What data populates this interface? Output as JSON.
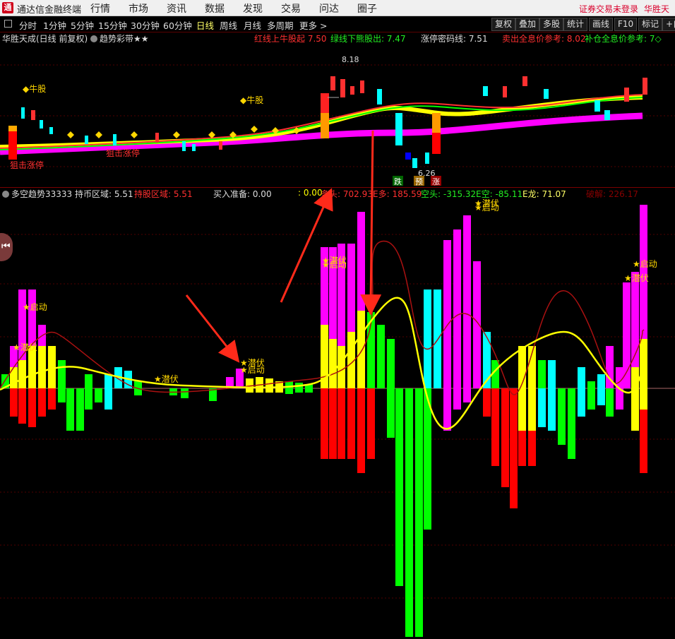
{
  "app": {
    "logo_text": "通",
    "title": "通达信金融终端",
    "menu": [
      "行情",
      "市场",
      "资讯",
      "数据",
      "发现",
      "交易",
      "问达",
      "圈子"
    ],
    "status_warn": "证券交易未登录",
    "stock_short": "华胜天成"
  },
  "toolbar": {
    "periods": [
      "分时",
      "1分钟",
      "5分钟",
      "15分钟",
      "30分钟",
      "60分钟",
      "日线",
      "周线",
      "月线",
      "多周期",
      "更多 >"
    ],
    "active_period": "日线",
    "right_buttons": [
      "复权",
      "叠加",
      "多股",
      "统计",
      "画线",
      "F10",
      "标记",
      "+自"
    ]
  },
  "main_panel": {
    "title": "华胜天成(日线 前复权)",
    "indicator": "趋势彩带★★",
    "red_line_label": "红线上牛股起 7.50",
    "green_line_label": "绿线下熊股出: 7.47",
    "limit_line_label": "涨停密码线: 7.51",
    "sell_label": "卖出全息价参考: 8.02",
    "buy_label": "补仓全息价参考: 7◇",
    "high_price": "8.18",
    "low_price": "6.26",
    "annotations": {
      "bull1": "◆牛股",
      "bull2": "◆牛股",
      "limit1": "狙击涨停",
      "limit2": "狙击涨停",
      "badge_fall": "跌",
      "badge_pre": "预",
      "badge_rise": "涨"
    }
  },
  "sub_panel": {
    "title": "多空趋势33333",
    "hold_coin": "持币区域: 5.51",
    "hold_stock": "持股区域: 5.51",
    "buy_prep": "买入准备: 0.00",
    "val_zero": ": 0.00",
    "duotou": "多头: 702.93",
    "e_duo": "E多: 185.59",
    "kongtou": "空头: -315.32",
    "e_kong": "E空: -85.11",
    "e_long": "E龙: 71.07",
    "pojie": "破解: 226.17",
    "signals": {
      "s1": "★启动",
      "s2": "★潜伏",
      "s3": "★潜伏",
      "s4": "★启动",
      "s5": "★潜伏",
      "s6": "★启动",
      "s7": "★潜伏",
      "s8": "★启动",
      "s9": "★潜伏",
      "s10": "★启动",
      "s11": "★潜伏"
    }
  },
  "colors": {
    "up": "#ff3030",
    "down": "#00ffff",
    "magenta": "#ff00ff",
    "yellow": "#ffff00",
    "green": "#00ff00",
    "red_bar": "#ff0000",
    "cyan_bar": "#33ffff",
    "gold": "#ffd700"
  }
}
